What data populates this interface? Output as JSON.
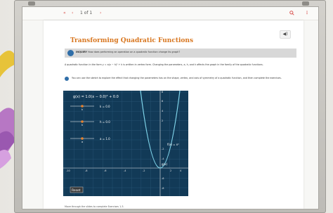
{
  "toolbar": {
    "prev_label": "«",
    "back_label": "‹",
    "page_indicator": "1 of 1",
    "forward_label": "›",
    "search_icon": "search-icon",
    "more_icon": "more-icon"
  },
  "lesson": {
    "title": "Transforming Quadratic Functions",
    "inquiry_label": "INQUIRY",
    "inquiry_question": "How does performing an operation on a quadratic function change its graph?",
    "intro_text": "A quadratic function in the form y = a(x − h)² + k is written in vertex form. Changing the parameters, a, h, and k affects the graph in the family of the quadratic functions.",
    "instruction_text": "You can use the sketch to explore the effect that changing the parameters has on the shape, vertex, and axis of symmetry of a quadratic function, and then complete the exercises.",
    "footer_text": "Move through the slides to complete Exercises 1-3."
  },
  "graph": {
    "equation_label": "g(x) = 1.0(x − 0.0)² + 0.0",
    "sliders": [
      {
        "label": "k = 0.0",
        "letter": "k"
      },
      {
        "label": "h = 0.0",
        "letter": "h"
      },
      {
        "label": "a = 1.0",
        "letter": "a"
      }
    ],
    "fx_label": "f(x) = x²",
    "gx_label": "g(x)",
    "reset_label": "Reset",
    "x_ticks": [
      "-10",
      "-8",
      "-6",
      "-4",
      "-2",
      "2",
      "4"
    ],
    "y_ticks": [
      "8",
      "6",
      "4",
      "2",
      "-2",
      "-4",
      "-6",
      "-8"
    ],
    "colors": {
      "background": "#123a57",
      "grid": "#2c5878",
      "curve": "#7fd4ea",
      "slider_handle": "#e8822d",
      "accent": "#d8761f"
    }
  }
}
